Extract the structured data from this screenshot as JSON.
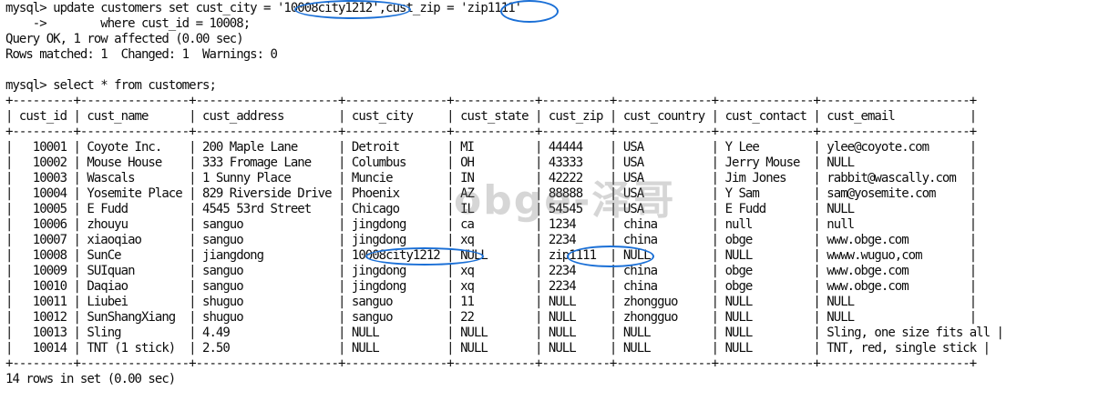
{
  "terminal": {
    "lines": [
      "mysql> update customers set cust_city = '10008city1212',cust_zip = 'zip1111'",
      "    ->        where cust_id = 10008;",
      "Query OK, 1 row affected (0.00 sec)",
      "Rows matched: 1  Changed: 1  Warnings: 0",
      "",
      "mysql> select * from customers;",
      "+---------+----------------+---------------------+---------------+------------+----------+--------------+--------------+----------------------+",
      "| cust_id | cust_name      | cust_address        | cust_city     | cust_state | cust_zip | cust_country | cust_contact | cust_email           |",
      "+---------+----------------+---------------------+---------------+------------+----------+--------------+--------------+----------------------+",
      "|   10001 | Coyote Inc.    | 200 Maple Lane      | Detroit       | MI         | 44444    | USA          | Y Lee        | ylee@coyote.com      |",
      "|   10002 | Mouse House    | 333 Fromage Lane    | Columbus      | OH         | 43333    | USA          | Jerry Mouse  | NULL                 |",
      "|   10003 | Wascals        | 1 Sunny Place       | Muncie        | IN         | 42222    | USA          | Jim Jones    | rabbit@wascally.com  |",
      "|   10004 | Yosemite Place | 829 Riverside Drive | Phoenix       | AZ         | 88888    | USA          | Y Sam        | sam@yosemite.com     |",
      "|   10005 | E Fudd         | 4545 53rd Street    | Chicago       | IL         | 54545    | USA          | E Fudd       | NULL                 |",
      "|   10006 | zhouyu         | sanguo              | jingdong      | ca         | 1234     | china        | null         | null                 |",
      "|   10007 | xiaoqiao       | sanguo              | jingdong      | xq         | 2234     | china        | obge         | www.obge.com         |",
      "|   10008 | SunCe          | jiangdong           | 10008city1212 | NULL       | zip1111  | NULL         | NULL         | wwww.wuguo,com       |",
      "|   10009 | SUIquan        | sanguo              | jingdong      | xq         | 2234     | china        | obge         | www.obge.com         |",
      "|   10010 | Daqiao         | sanguo              | jingdong      | xq         | 2234     | china        | obge         | www.obge.com         |",
      "|   10011 | Liubei         | shuguo              | sanguo        | 11         | NULL     | zhongguo     | NULL         | NULL                 |",
      "|   10012 | SunShangXiang  | shuguo              | sanguo        | 22         | NULL     | zhongguo     | NULL         | NULL                 |",
      "|   10013 | Sling          | 4.49                | NULL          | NULL       | NULL     | NULL         | NULL         | Sling, one size fits all |",
      "|   10014 | TNT (1 stick)  | 2.50                | NULL          | NULL       | NULL     | NULL         | NULL         | TNT, red, single stick |",
      "+---------+----------------+---------------------+---------------+------------+----------+--------------+--------------+----------------------+",
      "14 rows in set (0.00 sec)",
      ""
    ]
  },
  "watermark": "obge-泽哥",
  "colors": {
    "background": "#ffffff",
    "text": "#0c0c0c",
    "highlight_ellipse": "#1a6fd6",
    "watermark": "rgba(120,120,120,0.30)"
  }
}
